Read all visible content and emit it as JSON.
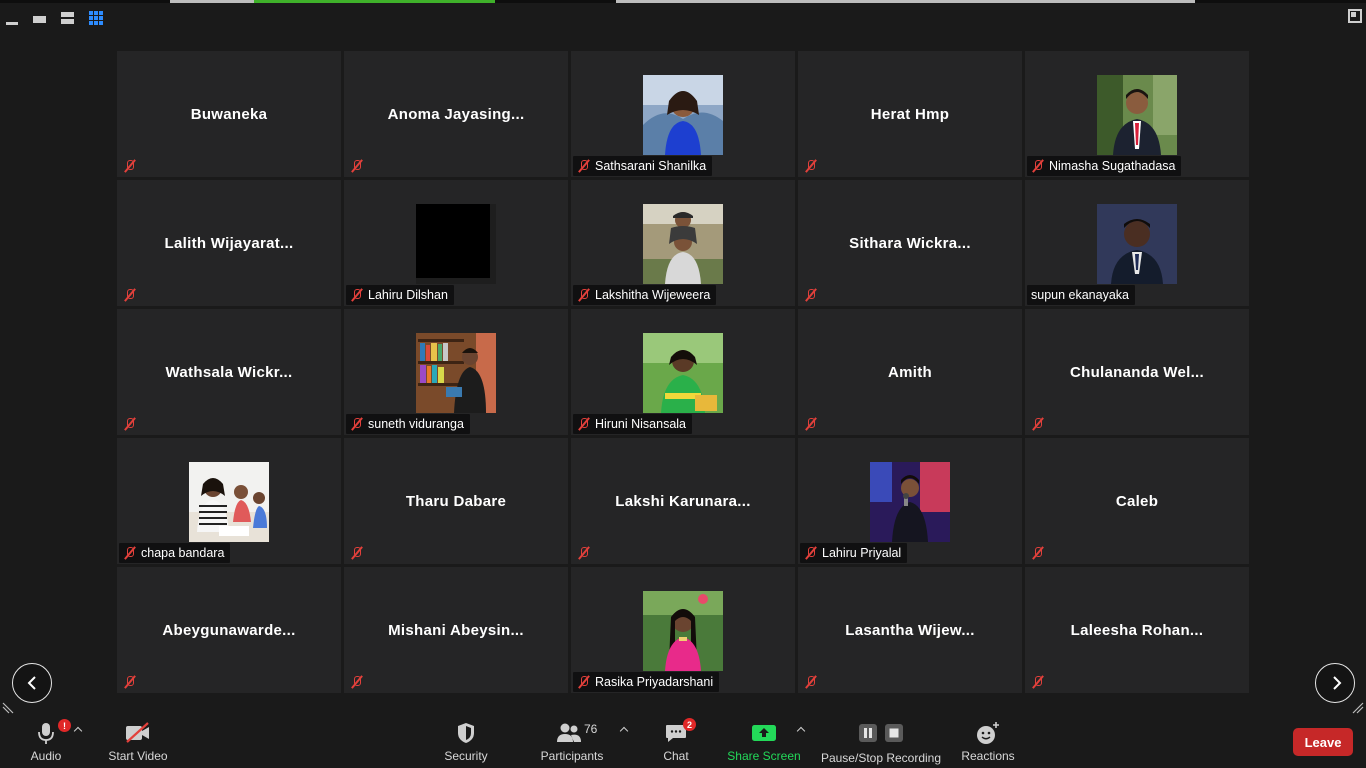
{
  "view_controls": {
    "items": [
      {
        "icon": "minimize-view-icon"
      },
      {
        "icon": "speaker-view-icon"
      },
      {
        "icon": "split-view-icon"
      },
      {
        "icon": "gallery-view-icon",
        "active": true
      }
    ]
  },
  "gallery": {
    "tiles": [
      {
        "display_name": "Buwaneka",
        "tag": "",
        "muted": true,
        "photo": null
      },
      {
        "display_name": "Anoma  Jayasing...",
        "tag": "",
        "muted": true,
        "photo": null
      },
      {
        "display_name": "",
        "tag": "Sathsarani Shanilka",
        "muted": true,
        "photo": "woman-blue-dress"
      },
      {
        "display_name": "Herat Hmp",
        "tag": "",
        "muted": true,
        "photo": null
      },
      {
        "display_name": "",
        "tag": "Nimasha Sugathadasa",
        "muted": true,
        "photo": "man-suit-red-tie"
      },
      {
        "display_name": "Lalith  Wijayarat...",
        "tag": "",
        "muted": true,
        "photo": null
      },
      {
        "display_name": "",
        "tag": "Lahiru Dilshan",
        "muted": true,
        "photo": "black-square"
      },
      {
        "display_name": "",
        "tag": "Lakshitha Wijeweera",
        "muted": true,
        "photo": "two-boys"
      },
      {
        "display_name": "Sithara  Wickra...",
        "tag": "",
        "muted": true,
        "photo": null
      },
      {
        "display_name": "",
        "tag": "supun ekanayaka",
        "muted": false,
        "photo": "man-dark-suit"
      },
      {
        "display_name": "Wathsala  Wickr...",
        "tag": "",
        "muted": true,
        "photo": null
      },
      {
        "display_name": "",
        "tag": "suneth viduranga",
        "muted": true,
        "photo": "man-bookshelf"
      },
      {
        "display_name": "",
        "tag": "Hiruni Nisansala",
        "muted": true,
        "photo": "woman-green-jersey"
      },
      {
        "display_name": "Amith",
        "tag": "",
        "muted": true,
        "photo": null
      },
      {
        "display_name": "Chulananda  Wel...",
        "tag": "",
        "muted": true,
        "photo": null
      },
      {
        "display_name": "",
        "tag": "chapa bandara",
        "muted": true,
        "photo": "students-classroom"
      },
      {
        "display_name": "Tharu Dabare",
        "tag": "",
        "muted": true,
        "photo": null
      },
      {
        "display_name": "Lakshi  Karunara...",
        "tag": "",
        "muted": true,
        "photo": null
      },
      {
        "display_name": "",
        "tag": "Lahiru Priyalal",
        "muted": true,
        "photo": "singer-stage"
      },
      {
        "display_name": "Caleb",
        "tag": "",
        "muted": true,
        "photo": null
      },
      {
        "display_name": "Abeygunawarde...",
        "tag": "",
        "muted": true,
        "photo": null
      },
      {
        "display_name": "Mishani  Abeysin...",
        "tag": "",
        "muted": true,
        "photo": null
      },
      {
        "display_name": "",
        "tag": "Rasika Priyadarshani",
        "muted": true,
        "photo": "woman-pink-saree"
      },
      {
        "display_name": "Lasantha  Wijew...",
        "tag": "",
        "muted": true,
        "photo": null
      },
      {
        "display_name": "Laleesha  Rohan...",
        "tag": "",
        "muted": true,
        "photo": null
      }
    ]
  },
  "toolbar": {
    "audio_label": "Audio",
    "audio_badge": "!",
    "video_label": "Start Video",
    "security_label": "Security",
    "participants_label": "Participants",
    "participants_count": "76",
    "chat_label": "Chat",
    "chat_badge": "2",
    "share_label": "Share Screen",
    "record_label": "Pause/Stop Recording",
    "reactions_label": "Reactions",
    "leave_label": "Leave"
  },
  "colors": {
    "accent_blue": "#2d8cff",
    "share_green": "#23d959",
    "mute_red": "#e2403b",
    "leave_red": "#c62828",
    "tile_bg": "#252526",
    "app_bg": "#1a1a1a"
  }
}
